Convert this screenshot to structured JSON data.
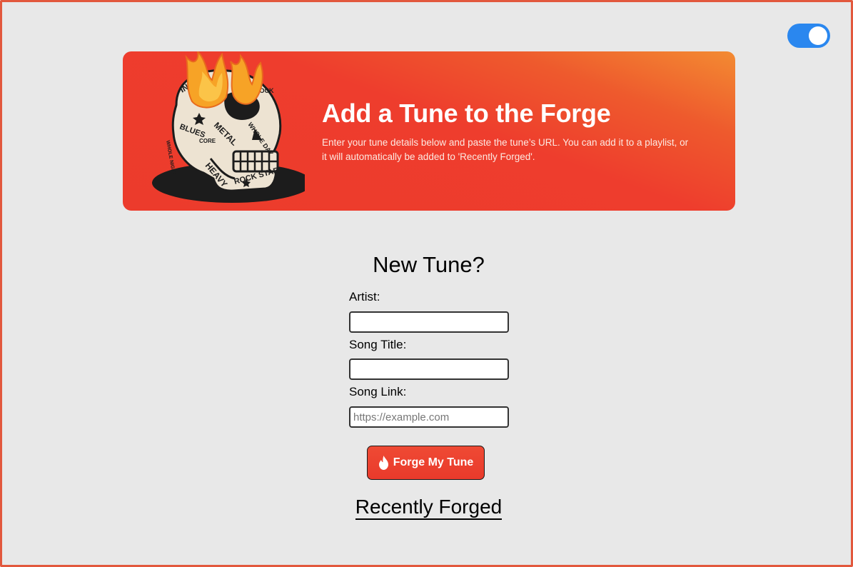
{
  "theme_toggle": {
    "state": "on",
    "color": "#2a87ef"
  },
  "hero": {
    "title": "Add a Tune to the Forge",
    "description": "Enter your tune details below and paste the tune’s URL. You can add it to a playlist, or it will automatically be added to 'Recently Forged'.",
    "illustration": "flaming-skull-illustration",
    "illustration_words": [
      "INDIE",
      "ROCK",
      "BLUES",
      "METAL",
      "WHOLE DAY",
      "HEAVY",
      "ROCK STAR",
      "CORE",
      "WHOLE NIGHT",
      "GROOVE",
      "ROCK"
    ],
    "gradient_colors": [
      "#ee3d2d",
      "#f38b32"
    ]
  },
  "form": {
    "title": "New Tune?",
    "artist": {
      "label": "Artist:",
      "value": "",
      "placeholder": ""
    },
    "song_title": {
      "label": "Song Title:",
      "value": "",
      "placeholder": ""
    },
    "song_link": {
      "label": "Song Link:",
      "value": "",
      "placeholder": "https://example.com"
    },
    "submit": {
      "label": "Forge My Tune",
      "icon": "flame-icon",
      "color": "#ec412f"
    }
  },
  "recently_forged": {
    "title": "Recently Forged"
  },
  "colors": {
    "background": "#e8e8e8",
    "frame_border": "#e2583d"
  }
}
